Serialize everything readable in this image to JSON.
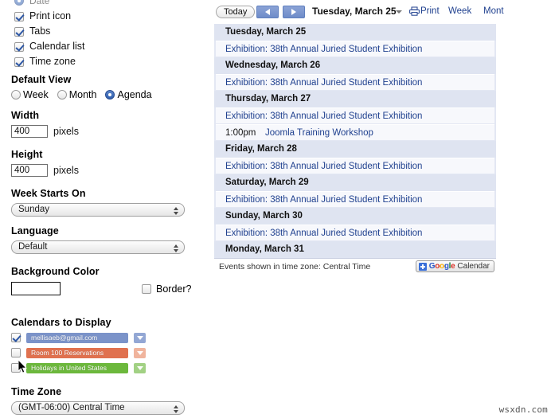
{
  "config_panel": {
    "cut_off_row": {
      "label": "Date",
      "checked": true
    },
    "display_options": [
      {
        "label": "Print icon",
        "checked": true
      },
      {
        "label": "Tabs",
        "checked": true
      },
      {
        "label": "Calendar list",
        "checked": true
      },
      {
        "label": "Time zone",
        "checked": true
      }
    ],
    "default_view": {
      "title": "Default View",
      "options": [
        {
          "label": "Week",
          "selected": false
        },
        {
          "label": "Month",
          "selected": false
        },
        {
          "label": "Agenda",
          "selected": true
        }
      ]
    },
    "width": {
      "title": "Width",
      "value": "400",
      "unit": "pixels"
    },
    "height": {
      "title": "Height",
      "value": "400",
      "unit": "pixels"
    },
    "week_starts_on": {
      "title": "Week Starts On",
      "value": "Sunday"
    },
    "language": {
      "title": "Language",
      "value": "Default"
    },
    "background_color": {
      "title": "Background Color",
      "value": "#ffffff"
    },
    "border": {
      "label": "Border?",
      "checked": false
    },
    "calendars_to_display": {
      "title": "Calendars to Display",
      "items": [
        {
          "label": "mellisaeb@gmail.com",
          "checked": true,
          "color": "#7b93c9",
          "caret_color": "#93a7d4"
        },
        {
          "label": "Room 100 Reservations",
          "checked": false,
          "color": "#e0714f",
          "caret_color": "#f0b49d"
        },
        {
          "label": "Holidays in United States",
          "checked": false,
          "color": "#6cb83c",
          "caret_color": "#a2d184"
        }
      ]
    },
    "time_zone": {
      "title": "Time Zone",
      "value": "(GMT-06:00) Central Time"
    }
  },
  "gcal": {
    "toolbar": {
      "today_label": "Today",
      "prev_label": "Previous",
      "next_label": "Next",
      "current_date": "Tuesday, March 25",
      "print_label": "Print",
      "tabs": [
        {
          "label": "Week"
        },
        {
          "label": "Mont"
        }
      ]
    },
    "agenda": [
      {
        "day": "Tuesday, March 25",
        "events": [
          {
            "time": "",
            "title": "Exhibition: 38th Annual Juried Student Exhibition",
            "linked": true
          }
        ]
      },
      {
        "day": "Wednesday, March 26",
        "events": [
          {
            "time": "",
            "title": "Exhibition: 38th Annual Juried Student Exhibition",
            "linked": true
          }
        ]
      },
      {
        "day": "Thursday, March 27",
        "events": [
          {
            "time": "",
            "title": "Exhibition: 38th Annual Juried Student Exhibition",
            "linked": true
          },
          {
            "time": "1:00pm",
            "title": "Joomla Training Workshop",
            "linked": true
          }
        ]
      },
      {
        "day": "Friday, March 28",
        "events": [
          {
            "time": "",
            "title": "Exhibition: 38th Annual Juried Student Exhibition",
            "linked": true
          }
        ]
      },
      {
        "day": "Saturday, March 29",
        "events": [
          {
            "time": "",
            "title": "Exhibition: 38th Annual Juried Student Exhibition",
            "linked": true
          }
        ]
      },
      {
        "day": "Sunday, March 30",
        "events": [
          {
            "time": "",
            "title": "Exhibition: 38th Annual Juried Student Exhibition",
            "linked": true
          }
        ]
      },
      {
        "day": "Monday, March 31",
        "events": []
      }
    ],
    "footer": {
      "timezone_note": "Events shown in time zone: Central Time",
      "badge_google": "Google",
      "badge_calendar": "Calendar"
    }
  },
  "watermark": "wsxdn.com"
}
